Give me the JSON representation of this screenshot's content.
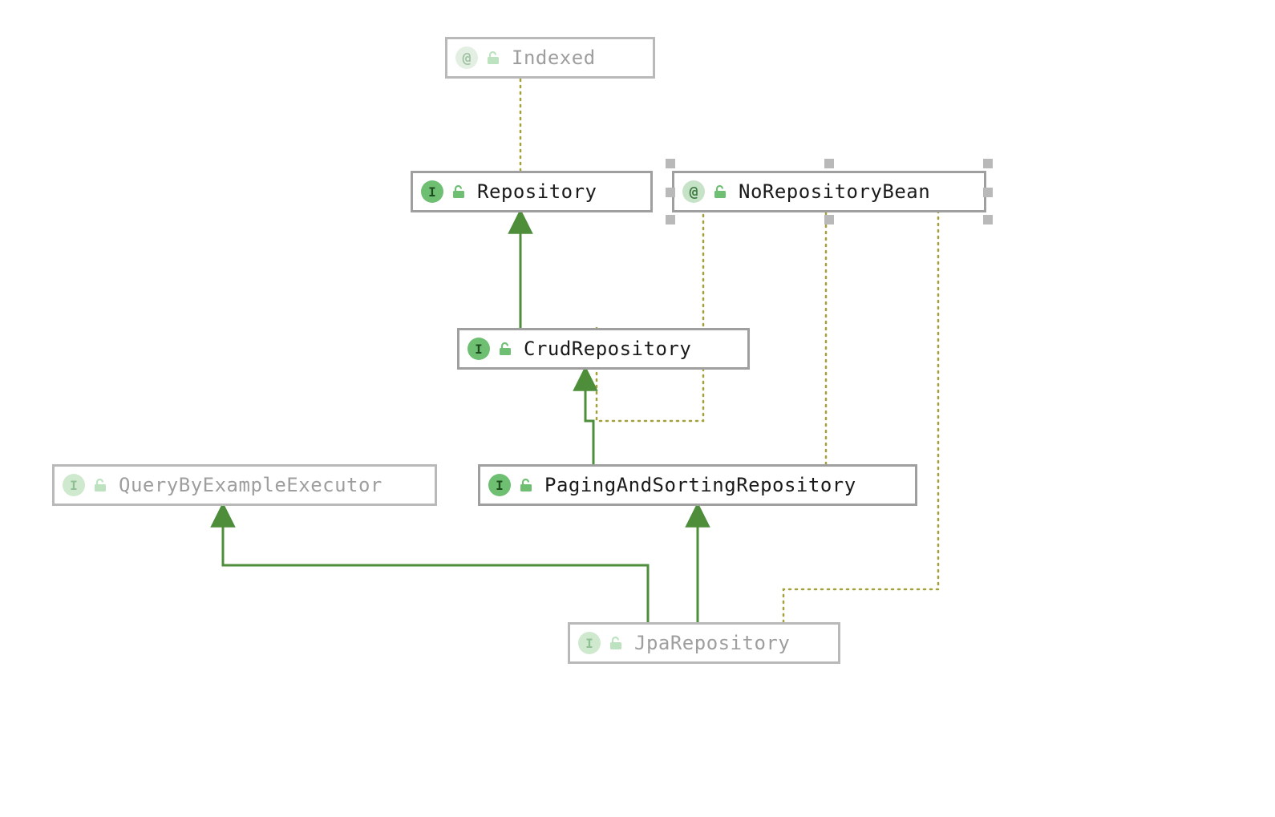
{
  "nodes": {
    "indexed": {
      "label": "Indexed",
      "kind": "@",
      "visibility": "unlocked"
    },
    "repository": {
      "label": "Repository",
      "kind": "I",
      "visibility": "unlocked"
    },
    "nrbean": {
      "label": "NoRepositoryBean",
      "kind": "@",
      "visibility": "unlocked"
    },
    "crud": {
      "label": "CrudRepository",
      "kind": "I",
      "visibility": "unlocked"
    },
    "qbe": {
      "label": "QueryByExampleExecutor",
      "kind": "I",
      "visibility": "unlocked"
    },
    "paging": {
      "label": "PagingAndSortingRepository",
      "kind": "I",
      "visibility": "unlocked"
    },
    "jpa": {
      "label": "JpaRepository",
      "kind": "I",
      "visibility": "unlocked"
    }
  },
  "selected": "nrbean",
  "arrows": {
    "solid": [
      {
        "from": "crud",
        "to": "repository"
      },
      {
        "from": "paging",
        "to": "crud"
      },
      {
        "from": "jpa",
        "to": "paging"
      },
      {
        "from": "jpa",
        "to": "qbe"
      }
    ],
    "dotted": [
      {
        "from": "repository",
        "to": "indexed"
      },
      {
        "from": "crud",
        "to": "nrbean"
      },
      {
        "from": "paging",
        "to": "nrbean"
      },
      {
        "from": "jpa",
        "to": "nrbean"
      }
    ]
  },
  "colors": {
    "arrow_solid": "#4e8e3b",
    "arrow_dotted": "#a4a13a",
    "node_border_solid": "#9f9f9f",
    "node_border_faded": "#b9b9b9",
    "label_faded": "#9e9e9e"
  }
}
